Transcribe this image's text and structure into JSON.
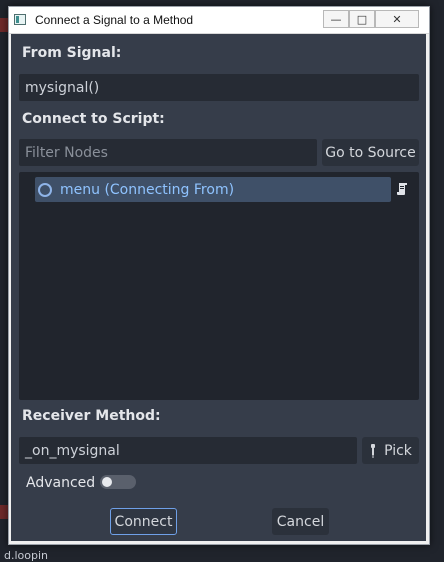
{
  "window": {
    "title": "Connect a Signal to a Method",
    "controls": {
      "minimize": "—",
      "maximize": "□",
      "close": "✕"
    }
  },
  "from_signal": {
    "label": "From Signal:",
    "value": "mysignal()"
  },
  "connect_to_script": {
    "label": "Connect to Script:",
    "filter_placeholder": "Filter Nodes",
    "go_to_source_label": "Go to Source",
    "tree_items": [
      {
        "label": "menu (Connecting From)",
        "icon": "node-circle-icon",
        "selected": true
      }
    ],
    "script_icon": "script-icon"
  },
  "receiver_method": {
    "label": "Receiver Method:",
    "value": "_on_mysignal",
    "pick_label": "Pick",
    "pick_icon": "eyedropper-icon"
  },
  "advanced": {
    "label": "Advanced",
    "enabled": false
  },
  "buttons": {
    "connect": "Connect",
    "cancel": "Cancel"
  },
  "background": {
    "bottom_text": "d.loopin"
  },
  "colors": {
    "panel": "#363d4a",
    "accent": "#8fc3ff",
    "selection": "#3f5068",
    "focus_border": "#6fa0e8"
  }
}
